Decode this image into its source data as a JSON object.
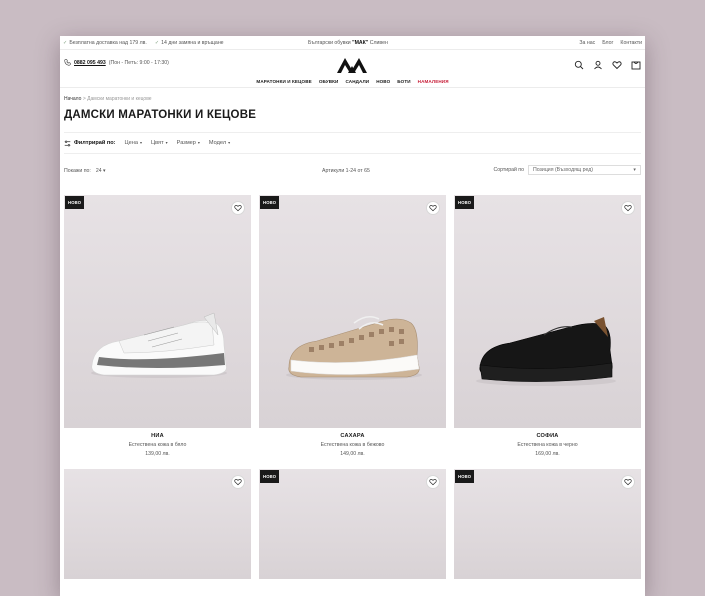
{
  "topbar": {
    "shipping": "Безплатна доставка над 179 лв.",
    "returns": "14 дни замяна и връщане",
    "brand_prefix": "Български обувки ",
    "brand_name": "\"МАК\"",
    "brand_suffix": " Сливен",
    "links": [
      "За нас",
      "Блог",
      "Контакти"
    ]
  },
  "header": {
    "phone": "0882 095 493",
    "hours": "(Пон - Петъ: 9:00 - 17:30)",
    "nav": [
      "МАРАТОНКИ И КЕЦОВЕ",
      "ОБУВКИ",
      "САНДАЛИ",
      "НОВО",
      "БОТИ",
      "НАМАЛЕНИЯ"
    ],
    "icons": [
      "search-icon",
      "user-icon",
      "heart-icon",
      "bag-icon"
    ]
  },
  "breadcrumb": {
    "home": "Начало",
    "sep": ">",
    "current": "Дамски маратонки и кецове"
  },
  "page_title": "ДАМСКИ МАРАТОНКИ И КЕЦОВЕ",
  "filters": {
    "label": "Филтрирай по:",
    "options": [
      "Цена",
      "Цвят",
      "Размер",
      "Модел"
    ]
  },
  "toolbar": {
    "show_label": "Покажи по:",
    "show_value": "24",
    "count": "Артикули 1-24 от 65",
    "sort_label": "Сортирай по",
    "sort_value": "Позиция (Възходящ ред)"
  },
  "badge_label": "НОВО",
  "products": [
    {
      "name": "НИА",
      "desc": "Естествена кожа в бяло",
      "price": "139,00 лв.",
      "badge": true,
      "color": "#f2f2f2"
    },
    {
      "name": "САХАРА",
      "desc": "Естествена кожа в бежово",
      "price": "149,00 лв.",
      "badge": true,
      "color": "#cbb39a"
    },
    {
      "name": "СОФИА",
      "desc": "Естествена кожа в черно",
      "price": "169,00 лв.",
      "badge": true,
      "color": "#151515"
    },
    {
      "name": "",
      "desc": "",
      "price": "",
      "badge": false
    },
    {
      "name": "",
      "desc": "",
      "price": "",
      "badge": true
    },
    {
      "name": "",
      "desc": "",
      "price": "",
      "badge": true
    }
  ],
  "colors": {
    "accent": "#c8203a",
    "badge_bg": "#1a1a1a",
    "backdrop": "#c9bcc3"
  }
}
